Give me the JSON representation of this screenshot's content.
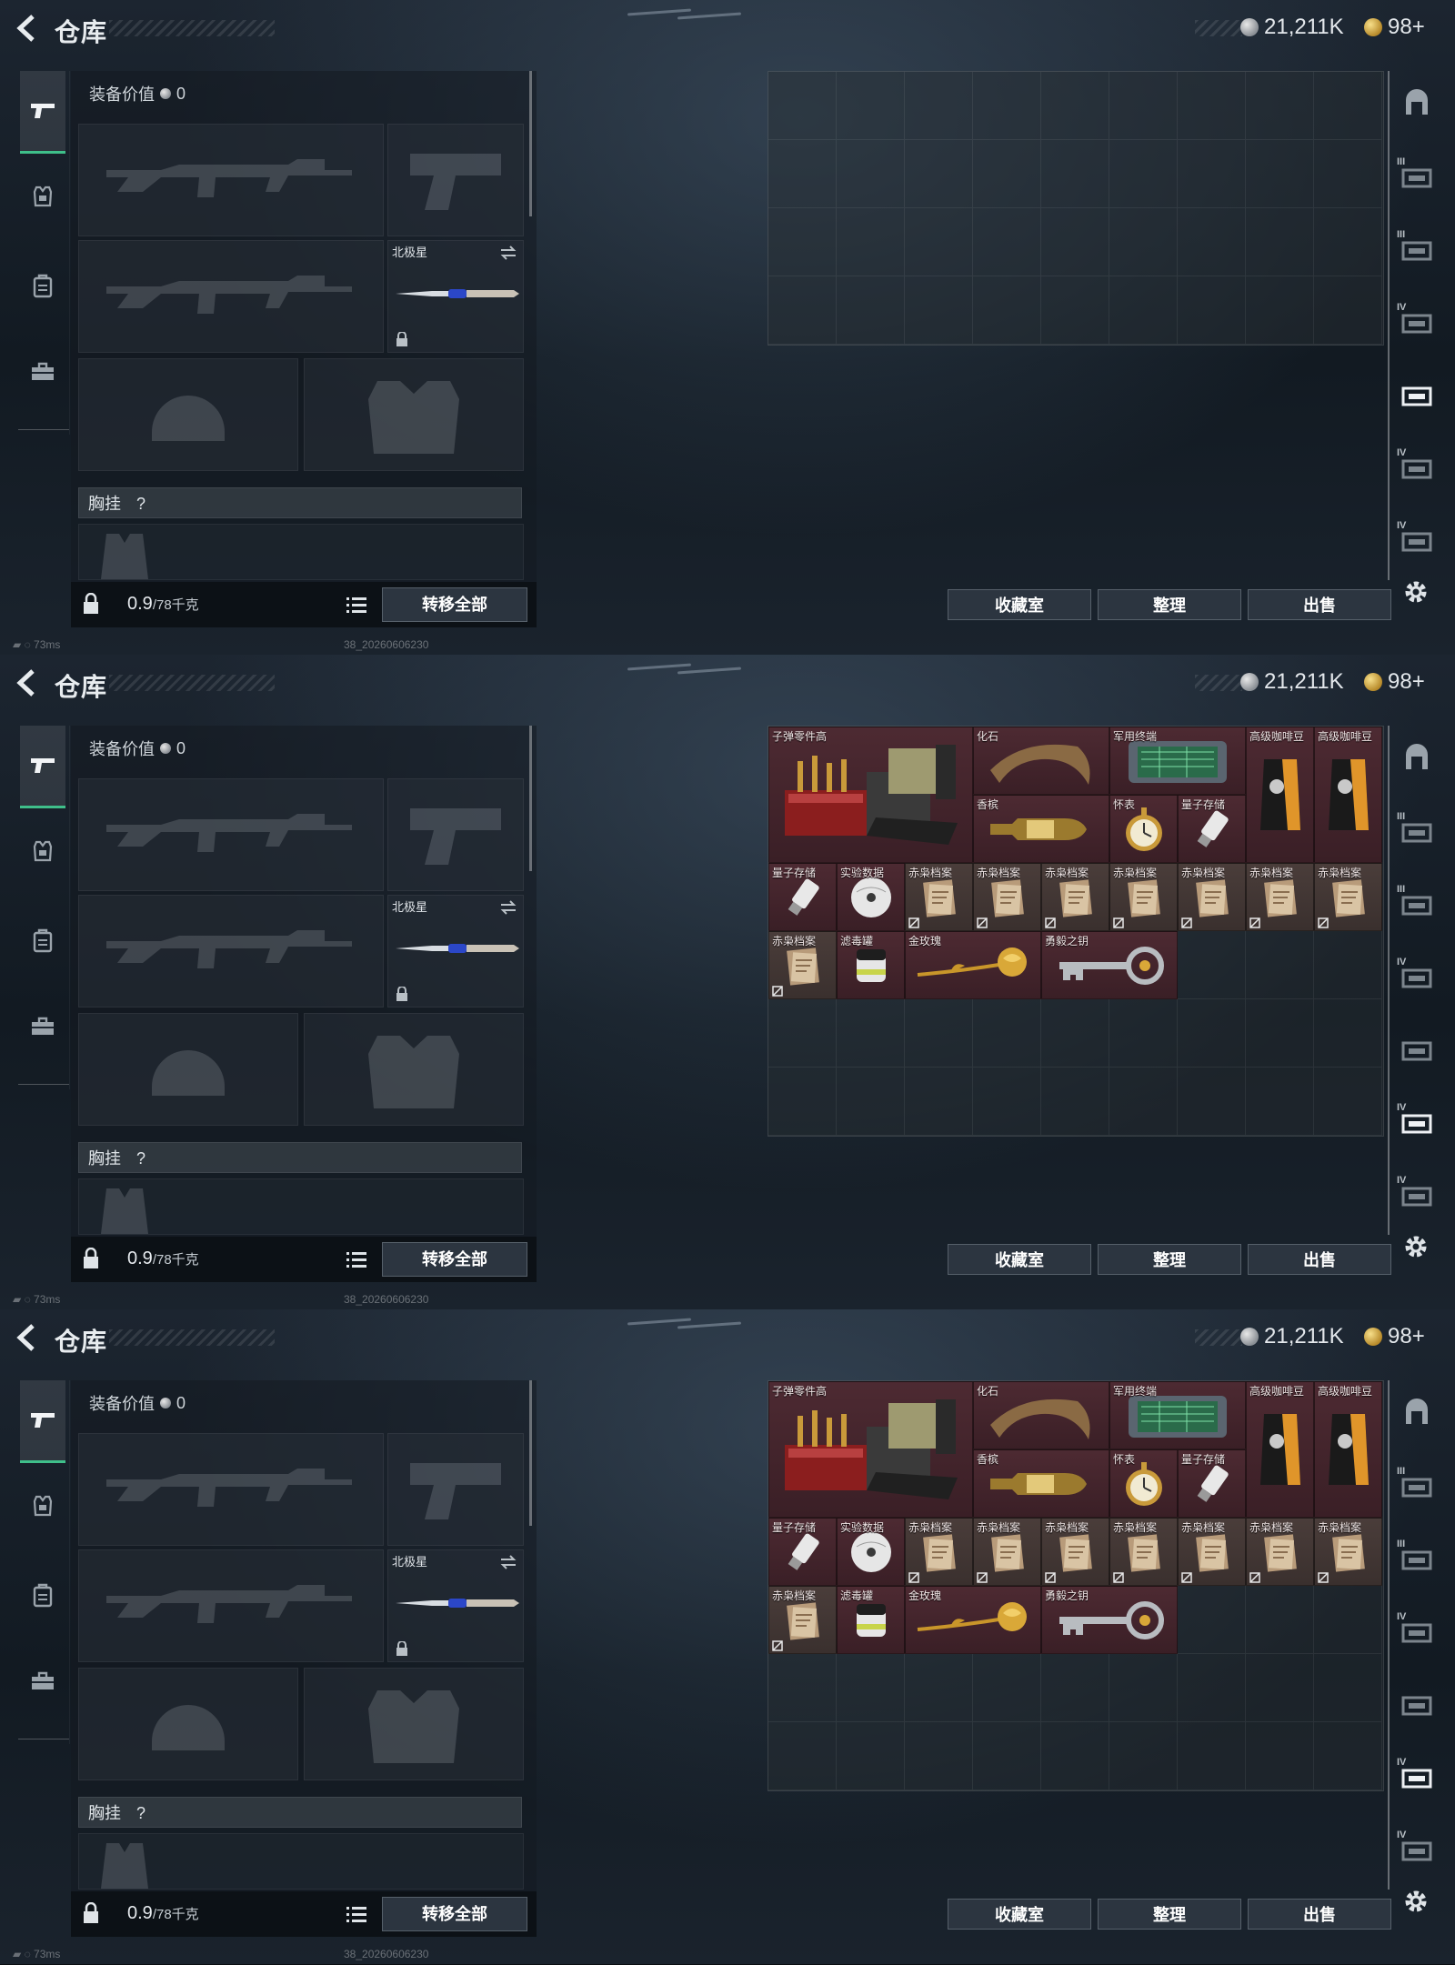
{
  "panels": [
    {
      "id": "p1",
      "header": {
        "title": "仓库",
        "silver_amount": "21,211K",
        "gold_amount": "98+"
      },
      "loadout": {
        "equipment_value_label": "装备价值",
        "equipment_value": "0",
        "melee_slot_name": "北极星",
        "chest_rig_label": "胸挂",
        "chest_rig_help": "?",
        "weight_current": "0.9",
        "weight_max": "/78千克",
        "transfer_all_label": "转移全部"
      },
      "status": {
        "ping": "73ms",
        "build_id": "38_20260606230"
      },
      "storage": {
        "has_items": false
      },
      "buttons": {
        "collection": "收藏室",
        "organize": "整理",
        "sell": "出售"
      }
    },
    {
      "id": "p2",
      "header": {
        "title": "仓库",
        "silver_amount": "21,211K",
        "gold_amount": "98+"
      },
      "loadout": {
        "equipment_value_label": "装备价值",
        "equipment_value": "0",
        "melee_slot_name": "北极星",
        "chest_rig_label": "胸挂",
        "chest_rig_help": "?",
        "weight_current": "0.9",
        "weight_max": "/78千克",
        "transfer_all_label": "转移全部"
      },
      "status": {
        "ping": "73ms",
        "build_id": "38_20260606230"
      },
      "storage": {
        "has_items": true
      },
      "buttons": {
        "collection": "收藏室",
        "organize": "整理",
        "sell": "出售"
      }
    },
    {
      "id": "p3",
      "header": {
        "title": "仓库",
        "silver_amount": "21,211K",
        "gold_amount": "98+"
      },
      "loadout": {
        "equipment_value_label": "装备价值",
        "equipment_value": "0",
        "melee_slot_name": "北极星",
        "chest_rig_label": "胸挂",
        "chest_rig_help": "?",
        "weight_current": "0.9",
        "weight_max": "/78千克",
        "transfer_all_label": "转移全部"
      },
      "status": {
        "ping": "73ms",
        "build_id": "38_20260606230"
      },
      "storage": {
        "has_items": true
      },
      "buttons": {
        "collection": "收藏室",
        "organize": "整理",
        "sell": "出售"
      }
    }
  ],
  "storage_items": [
    {
      "name": "子弹零件高",
      "icon": "ammo-parts-icon",
      "bound": false
    },
    {
      "name": "化石",
      "icon": "fossil-claw-icon",
      "bound": false
    },
    {
      "name": "军用终端",
      "icon": "military-terminal-icon",
      "bound": false
    },
    {
      "name": "高级咖啡豆",
      "icon": "coffee-bag-icon",
      "bound": false
    },
    {
      "name": "高级咖啡豆",
      "icon": "coffee-bag-icon",
      "bound": false
    },
    {
      "name": "香槟",
      "icon": "champagne-icon",
      "bound": false
    },
    {
      "name": "怀表",
      "icon": "pocket-watch-icon",
      "bound": false
    },
    {
      "name": "量子存储",
      "icon": "usb-drive-icon",
      "bound": false
    },
    {
      "name": "量子存储",
      "icon": "usb-drive-icon",
      "bound": false
    },
    {
      "name": "实验数据",
      "icon": "data-disc-icon",
      "bound": false
    },
    {
      "name": "赤枭档案",
      "icon": "document-file-icon",
      "bound": true
    },
    {
      "name": "赤枭档案",
      "icon": "document-file-icon",
      "bound": true
    },
    {
      "name": "赤枭档案",
      "icon": "document-file-icon",
      "bound": true
    },
    {
      "name": "赤枭档案",
      "icon": "document-file-icon",
      "bound": true
    },
    {
      "name": "赤枭档案",
      "icon": "document-file-icon",
      "bound": true
    },
    {
      "name": "赤枭档案",
      "icon": "document-file-icon",
      "bound": true
    },
    {
      "name": "赤枭档案",
      "icon": "document-file-icon",
      "bound": true
    },
    {
      "name": "赤枭档案",
      "icon": "document-file-icon",
      "bound": true
    },
    {
      "name": "滤毒罐",
      "icon": "filter-canister-icon",
      "bound": false
    },
    {
      "name": "金玫瑰",
      "icon": "gold-rose-icon",
      "bound": false
    },
    {
      "name": "勇毅之钥",
      "icon": "key-icon",
      "bound": false
    }
  ],
  "right_nav_levels": [
    "",
    "III",
    "III",
    "IV",
    "",
    "IV",
    "IV"
  ],
  "colors": {
    "accent": "#3fbf8a",
    "item_bg": "#4d2a32"
  }
}
